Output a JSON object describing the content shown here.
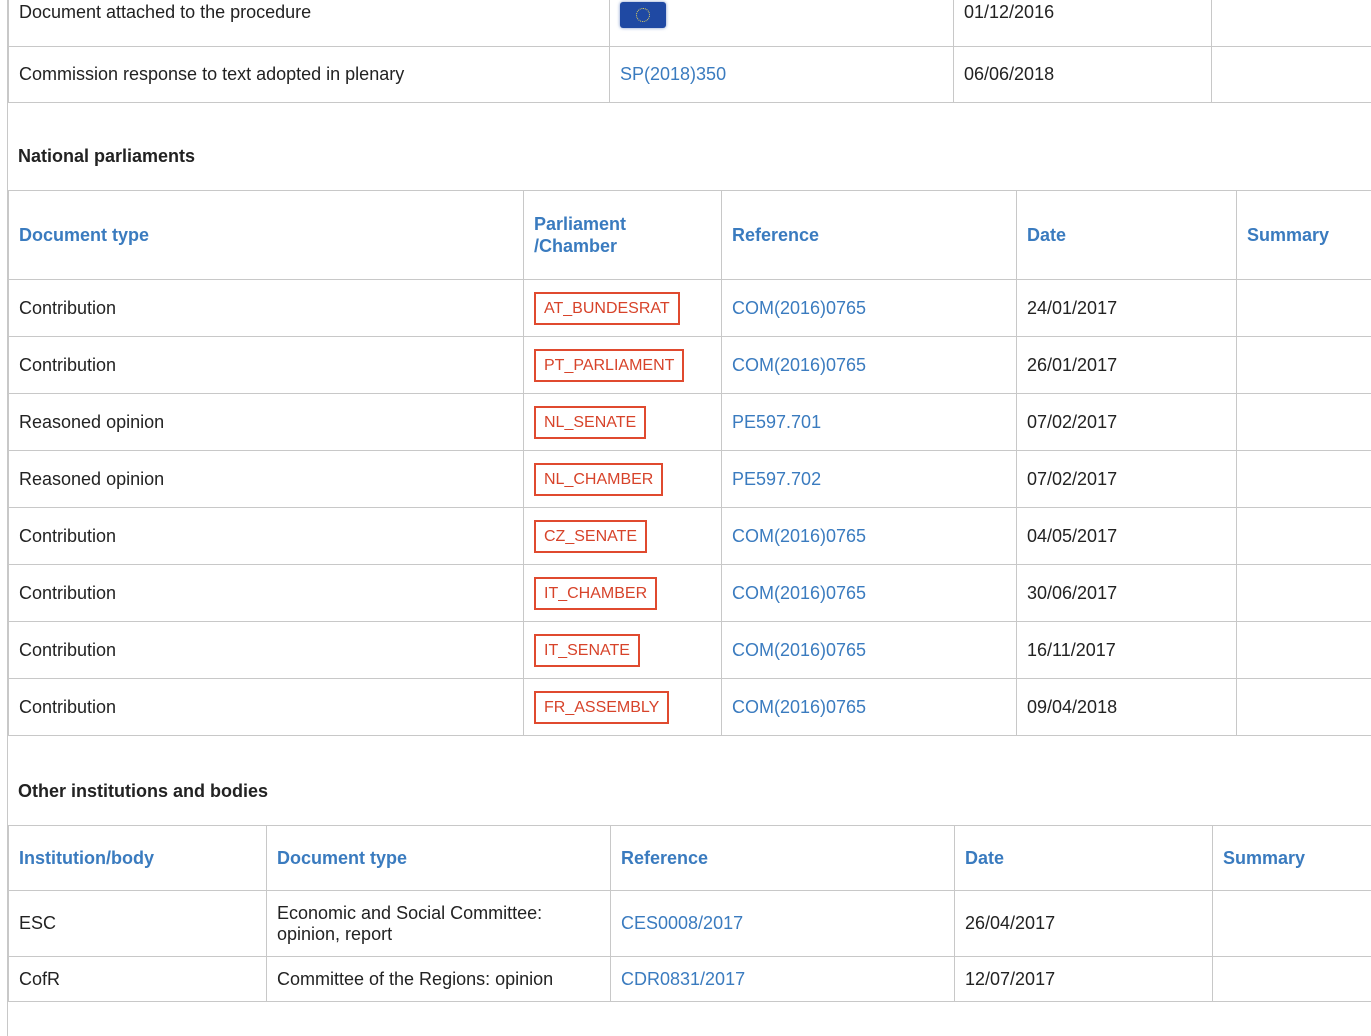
{
  "top_table": {
    "rows": [
      {
        "doc": "Document attached to the procedure",
        "ref_icon": "eu-flag-icon",
        "date": "01/12/2016",
        "summary": ""
      },
      {
        "doc": "Commission response to text adopted in plenary",
        "ref": "SP(2018)350",
        "date": "06/06/2018",
        "summary": ""
      }
    ]
  },
  "national": {
    "title": "National parliaments",
    "headers": {
      "doc_type": "Document type",
      "parliament": "Parliament /Chamber",
      "reference": "Reference",
      "date": "Date",
      "summary": "Summary"
    },
    "rows": [
      {
        "doc_type": "Contribution",
        "parliament": "AT_BUNDESRAT",
        "reference": "COM(2016)0765",
        "date": "24/01/2017"
      },
      {
        "doc_type": "Contribution",
        "parliament": "PT_PARLIAMENT",
        "reference": "COM(2016)0765",
        "date": "26/01/2017"
      },
      {
        "doc_type": "Reasoned opinion",
        "parliament": "NL_SENATE",
        "reference": "PE597.701",
        "date": "07/02/2017"
      },
      {
        "doc_type": "Reasoned opinion",
        "parliament": "NL_CHAMBER",
        "reference": "PE597.702",
        "date": "07/02/2017"
      },
      {
        "doc_type": "Contribution",
        "parliament": "CZ_SENATE",
        "reference": "COM(2016)0765",
        "date": "04/05/2017"
      },
      {
        "doc_type": "Contribution",
        "parliament": "IT_CHAMBER",
        "reference": "COM(2016)0765",
        "date": "30/06/2017"
      },
      {
        "doc_type": "Contribution",
        "parliament": "IT_SENATE",
        "reference": "COM(2016)0765",
        "date": "16/11/2017"
      },
      {
        "doc_type": "Contribution",
        "parliament": "FR_ASSEMBLY",
        "reference": "COM(2016)0765",
        "date": "09/04/2018"
      }
    ]
  },
  "other": {
    "title": "Other institutions and bodies",
    "headers": {
      "institution": "Institution/body",
      "doc_type": "Document type",
      "reference": "Reference",
      "date": "Date",
      "summary": "Summary"
    },
    "rows": [
      {
        "institution": "ESC",
        "doc_type": "Economic and Social Committee: opinion, report",
        "reference": "CES0008/2017",
        "date": "26/04/2017"
      },
      {
        "institution": "CofR",
        "doc_type": "Committee of the Regions: opinion",
        "reference": "CDR0831/2017",
        "date": "12/07/2017"
      }
    ]
  },
  "colors": {
    "link": "#3a7bbf",
    "chip_border": "#e04a2f",
    "border": "#c8c8c8"
  }
}
